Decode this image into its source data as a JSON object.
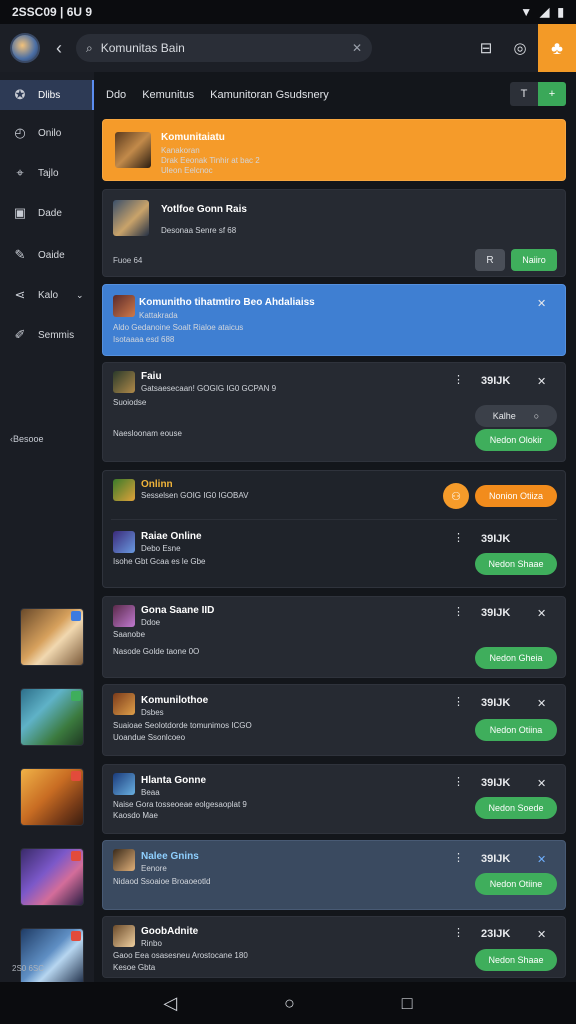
{
  "status_bar": {
    "time": "2SSC09 | 6U 9"
  },
  "search": {
    "text": "Komunitas Bain",
    "clear_icon": "clear-icon"
  },
  "sidebar": {
    "items": [
      {
        "label": "Dlibs",
        "icon": "compass-icon"
      },
      {
        "label": "Onilo",
        "icon": "clock-icon"
      },
      {
        "label": "Tajlo",
        "icon": "pin-icon"
      },
      {
        "label": "Dade",
        "icon": "image-icon"
      },
      {
        "label": "Oaide",
        "icon": "edit-icon"
      },
      {
        "label": "Kalo",
        "icon": "share-icon"
      },
      {
        "label": "Semmis",
        "icon": "pencil-icon"
      }
    ],
    "sub_label": "Besooe",
    "footer": "2S0 6SC"
  },
  "tabs": [
    "Ddo",
    "Kemunitus",
    "Kamunitoran Gsudsnery"
  ],
  "tab_tools": {
    "left": "T",
    "right": "+"
  },
  "cards": [
    {
      "title": "Komunitaiatu",
      "line1": "Kanakoran",
      "line2": "Drak Eeonak Tinhir at bac 2",
      "line3": "Uleon Eelcnoc"
    },
    {
      "title": "Yotlfoe Gonn Rais",
      "line1": "Desonaa Senre sf 68",
      "meta": "Fuoe 64",
      "btn_left": "R",
      "btn_right": "Naiiro"
    },
    {
      "title": "Komunitho tihatmtiro Beo Ahdaliaiss",
      "line1": "Kattakrada",
      "line2": "Aldo Gedanoine Soalt Rialoe ataicus",
      "line3": "Isotaaaa esd 688"
    },
    {
      "title": "Faiu",
      "line1": "Gatsaesecaan! GOGIG IG0 GCPAN 9",
      "line2": "Suoiodse",
      "line3": "Naesloonam eouse",
      "count": "39IJK",
      "pill_top": "Kalhe",
      "pill_bottom": "Nedon Olokir"
    },
    {
      "title": "Onlinn",
      "line1": "Sesselsen GOIG IG0 IGOBAV",
      "action": "Nonion Otiiza",
      "sub_title": "Raiae Online",
      "sub_line1": "Debo Esne",
      "sub_line2": "Isohe Gbt Gcaa es le Gbe",
      "count": "39IJK",
      "pill": "Nedon Shaae"
    },
    {
      "title": "Gona Saane IID",
      "line1": "Ddoe",
      "line2": "Saanobe",
      "line3": "Nasode Golde taone 0O",
      "count": "39IJK",
      "pill": "Nedon Gheia"
    },
    {
      "title": "Komunilothoe",
      "line1": "Dsbes",
      "line2": "Suaioae Seolotdorde tomunimos ICGO",
      "line3": "Uoandue Ssonlcoeo",
      "count": "39IJK",
      "pill": "Nedon Otiina"
    },
    {
      "title": "Hlanta Gonne",
      "line1": "Beaa",
      "line2": "Naise Gora tosseoeae eolgesaoplat 9",
      "line3": "Kaosdo Mae",
      "count": "39IJK",
      "pill": "Nedon Soede"
    },
    {
      "title": "Nalee Gnins",
      "line1": "Eenore",
      "line2": "Nidaod Ssoaioe Broaoeotld",
      "count": "39IJK",
      "pill": "Nedon Otiine"
    },
    {
      "title": "GoobAdnite",
      "line1": "Rinbo",
      "line2": "Gaoo Eea osasesneu Arostocane 180",
      "line3": "Kesoe Gbta",
      "count": "23IJK",
      "pill": "Nedon Shaae"
    }
  ],
  "colors": {
    "accent_orange": "#f59b2a",
    "accent_blue": "#3f7fd2",
    "green": "#3fae5c",
    "bg": "#13161b"
  }
}
